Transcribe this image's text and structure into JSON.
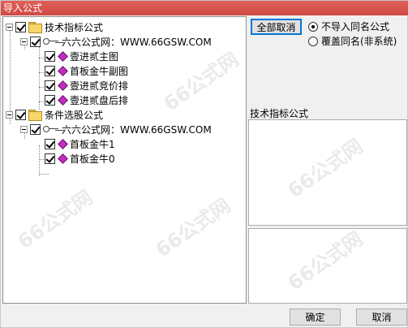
{
  "window": {
    "title": "导入公式"
  },
  "tree": [
    {
      "label": "技术指标公式",
      "type": "folder",
      "level": 0,
      "checked": true
    },
    {
      "label": "六六公式网：WWW.66GSW.COM",
      "type": "key",
      "level": 1,
      "checked": true
    },
    {
      "label": "壹进贰主图",
      "type": "formula",
      "level": 2,
      "checked": true
    },
    {
      "label": "首板金牛副图",
      "type": "formula",
      "level": 2,
      "checked": true
    },
    {
      "label": "壹进贰竞价排",
      "type": "formula",
      "level": 2,
      "checked": true
    },
    {
      "label": "壹进贰盘后排",
      "type": "formula",
      "level": 2,
      "checked": true
    },
    {
      "label": "条件选股公式",
      "type": "folder",
      "level": 0,
      "checked": true
    },
    {
      "label": "六六公式网：WWW.66GSW.COM",
      "type": "key",
      "level": 1,
      "checked": true
    },
    {
      "label": "首板金牛1",
      "type": "formula",
      "level": 2,
      "checked": true
    },
    {
      "label": "首板金牛0",
      "type": "formula",
      "level": 2,
      "checked": true
    }
  ],
  "controls": {
    "select_all_cancel": "全部取消",
    "radio_no_import": "不导入同名公式",
    "radio_overwrite": "覆盖同名(非系统)",
    "category_label": "技术指标公式",
    "ok": "确定",
    "cancel": "取消"
  },
  "watermark": "66公式网"
}
